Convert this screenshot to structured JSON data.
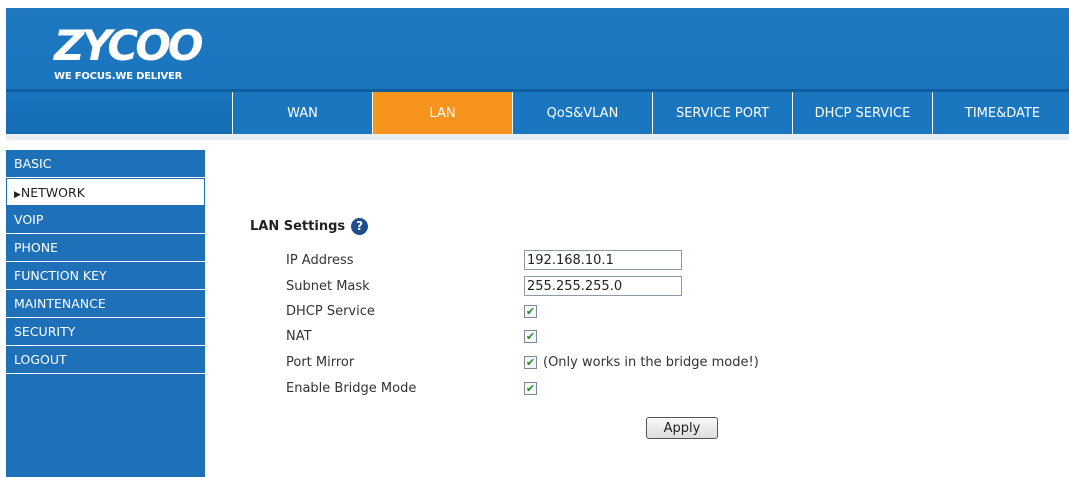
{
  "header": {
    "brand": "ZYCOO",
    "tagline": "WE FOCUS.WE DELIVER",
    "tabs": [
      {
        "label": "WAN",
        "active": false
      },
      {
        "label": "LAN",
        "active": true
      },
      {
        "label": "QoS&VLAN",
        "active": false
      },
      {
        "label": "SERVICE PORT",
        "active": false
      },
      {
        "label": "DHCP SERVICE",
        "active": false
      },
      {
        "label": "TIME&DATE",
        "active": false
      }
    ]
  },
  "sidebar": {
    "items": [
      {
        "label": "BASIC",
        "active": false
      },
      {
        "label": "NETWORK",
        "active": true
      },
      {
        "label": "VOIP",
        "active": false
      },
      {
        "label": "PHONE",
        "active": false
      },
      {
        "label": "FUNCTION KEY",
        "active": false
      },
      {
        "label": "MAINTENANCE",
        "active": false
      },
      {
        "label": "SECURITY",
        "active": false
      },
      {
        "label": "LOGOUT",
        "active": false
      }
    ]
  },
  "main": {
    "section_title": "LAN Settings",
    "ip_address": {
      "label": "IP Address",
      "value": "192.168.10.1"
    },
    "subnet_mask": {
      "label": "Subnet Mask",
      "value": "255.255.255.0"
    },
    "dhcp_service": {
      "label": "DHCP Service",
      "checked": true
    },
    "nat": {
      "label": "NAT",
      "checked": true
    },
    "port_mirror": {
      "label": "Port Mirror",
      "checked": true,
      "note": "(Only works in the bridge mode!)"
    },
    "bridge_mode": {
      "label": "Enable Bridge Mode",
      "checked": true
    },
    "apply_label": "Apply"
  },
  "colors": {
    "header_blue": "#1976bf",
    "active_tab": "#f7941d",
    "sidebar_blue": "#1e70b8",
    "help_icon": "#1e4e8c"
  }
}
